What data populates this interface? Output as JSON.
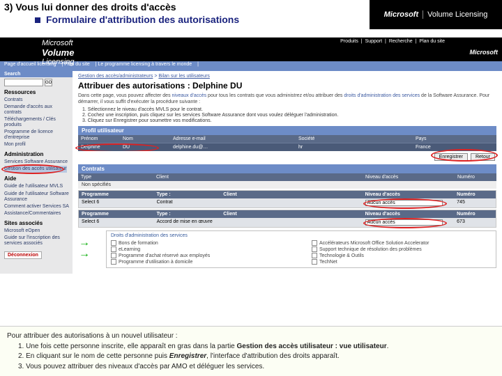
{
  "slide": {
    "title": "3) Vous lui donner des droits d'accès",
    "subtitle": "Formulaire d'attribution des autorisations",
    "brand_ms": "Microsoft",
    "brand_vl": "Volume Licensing"
  },
  "topbar": {
    "logo_line1": "Microsoft",
    "logo_line2": "Volume",
    "logo_line3": "Licensing",
    "links": [
      "Produits",
      "Support",
      "Recherche",
      "Plan du site"
    ],
    "ms_right": "Microsoft"
  },
  "nav": {
    "items": [
      "Page d'accueil licensing",
      "Plan du site",
      "Le programme licensing à travers le monde"
    ]
  },
  "sidebar": {
    "search_label": "Search",
    "search_placeholder": "",
    "go": "GO",
    "ressources_h": "Ressources",
    "ressources": [
      "Contrats",
      "Demande d'accès aux contrats",
      "Téléchargements / Clés produits",
      "Programme de licence d'entreprise",
      "Mon profil"
    ],
    "admin_h": "Administration",
    "admin": [
      "Services Software Assurance",
      "Gestion des accès utilisateur"
    ],
    "aide_h": "Aide",
    "aide": [
      "Guide de l'utilisateur MVLS",
      "Guide de l'utilisateur Software Assurance",
      "Comment activer Services SA",
      "Assistance/Commentaires"
    ],
    "sites_h": "Sites associés",
    "sites": [
      "Microsoft eOpen",
      "Guide sur l'inscription des services associés"
    ],
    "disconnect": "Déconnexion"
  },
  "main": {
    "breadcrumb_a": "Gestion des accès/administrateurs",
    "breadcrumb_sep": " > ",
    "breadcrumb_b": "Bilan sur les utilisateurs",
    "title": "Attribuer des autorisations : Delphine DU",
    "desc_before": "Dans cette page, vous pouvez affecter des ",
    "desc_link": "niveaux d'accès",
    "desc_mid": " pour tous les contrats que vous administrez et/ou attribuer des ",
    "desc_link2": "droits d'administration des services",
    "desc_after": " de la Software Assurance. Pour démarrer, il vous suffit d'exécuter la procédure suivante :",
    "step1": "1. Sélectionnez le niveau d'accès MVLS pour le contrat.",
    "step2": "2. Cochez une inscription, puis cliquez sur les services Software Assurance dont vous voulez déléguer l'administration.",
    "step3": "3. Cliquez sur Enregistrer pour soumettre vos modifications."
  },
  "profile": {
    "section": "Profil utilisateur",
    "h_prenom": "Prénom",
    "h_nom": "Nom",
    "h_mail": "Adresse e-mail",
    "h_soc": "Société",
    "h_pays": "Pays",
    "v_prenom": "Delphine",
    "v_nom": "DU",
    "v_mail": "delphine.du@…",
    "v_soc": "hr",
    "v_pays": "France",
    "btn_save": "Enregistrer",
    "btn_back": "Retour"
  },
  "contrats": {
    "section": "Contrats",
    "h_type": "Type",
    "h_client": "Client",
    "h_niveau": "Niveau d'accès",
    "h_num": "Numéro",
    "non_spec": "Non spécifiés",
    "block1": {
      "h_prog": "Programme",
      "h_type": "Type :",
      "h_client": "Client",
      "h_niv": "Niveau d'accès",
      "h_num": "Numéro",
      "v_prog": "Select 6",
      "v_type": "Contrat",
      "v_client": "",
      "v_niv": "Aucun accès",
      "v_num": "745"
    },
    "block2": {
      "h_prog": "Programme",
      "h_type": "Type :",
      "h_client": "Client",
      "h_niv": "Niveau d'accès",
      "h_num": "Numéro",
      "v_prog": "Select 6",
      "v_type": "Accord de mise en œuvre",
      "v_client": "",
      "v_niv": "Aucun accès",
      "v_num": "673"
    }
  },
  "rights": {
    "title": "Droits d'administration des services",
    "left": [
      "Bons de formation",
      "eLearning",
      "Programme d'achat réservé aux employés",
      "Programme d'utilisation à domicile"
    ],
    "right": [
      "Accélérateurs Microsoft Office Solution Accelerator",
      "Support technique de résolution des problèmes",
      "Technologie & Outils",
      "TechNet"
    ]
  },
  "footnote": {
    "l0": "Pour attribuer des autorisations à un nouvel utilisateur :",
    "l1a": "1. Une fois cette personne inscrite, elle apparaît en gras dans la partie ",
    "l1b": "Gestion des accès utilisateur : vue utilisateur",
    "l1c": ".",
    "l2a": "2. En cliquant sur le nom de cette personne puis ",
    "l2b": "Enregistrer",
    "l2c": ", l'interface d'attribution des droits apparaît.",
    "l3": "3. Vous pouvez attribuer des niveaux d'accès par AMO et déléguer les services."
  }
}
